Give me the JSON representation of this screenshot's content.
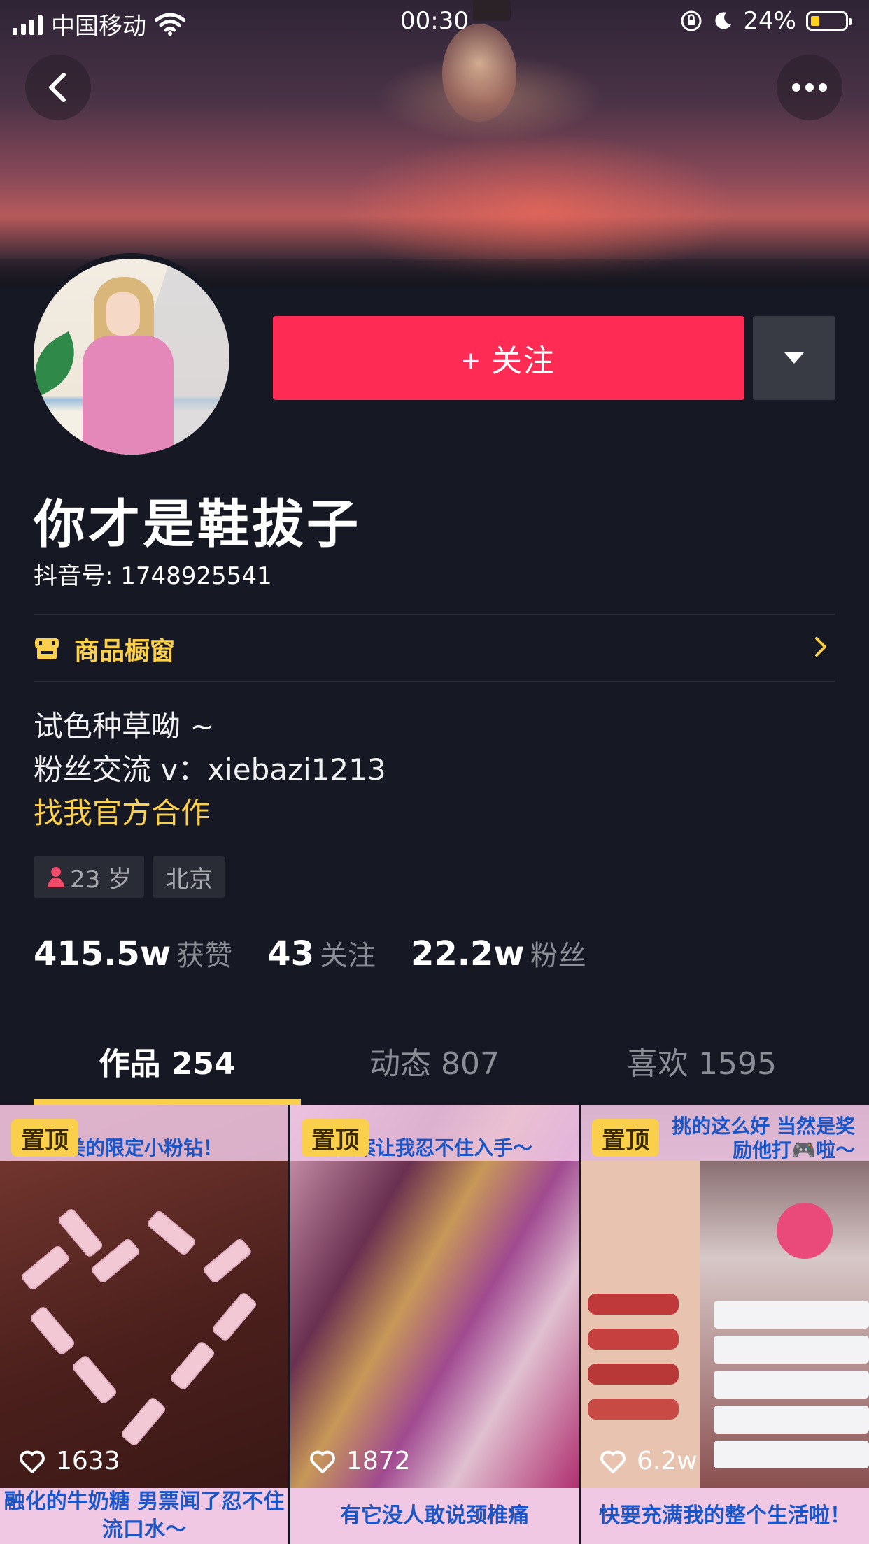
{
  "status_bar": {
    "carrier": "中国移动",
    "time": "00:30",
    "battery": "24%"
  },
  "profile": {
    "follow_label": "+ 关注",
    "nickname": "你才是鞋拔子",
    "douyin_id": "抖音号: 1748925541",
    "shop_label": "商品橱窗",
    "bio_line1": "试色种草呦 ~",
    "bio_line2": "粉丝交流 v：xiebazi1213",
    "bio_line3": "找我官方合作",
    "tag_age": "23 岁",
    "tag_city": "北京"
  },
  "stats": [
    {
      "value": "415.5w",
      "label": "获赞"
    },
    {
      "value": "43",
      "label": "关注"
    },
    {
      "value": "22.2w",
      "label": "粉丝"
    }
  ],
  "tabs": [
    {
      "label": "作品 254"
    },
    {
      "label": "动态 807"
    },
    {
      "label": "喜欢 1595"
    }
  ],
  "videos": [
    {
      "pin": "置顶",
      "likes": "1633",
      "caption": "美的限定小粉钻！"
    },
    {
      "pin": "置顶",
      "likes": "1872",
      "caption": "图案让我忍不住入手～"
    },
    {
      "pin": "置顶",
      "likes": "6.2w",
      "caption": "挑的这么好 当然是奖励他打🎮啦～"
    }
  ],
  "videos_row2": [
    {
      "caption": "融化的牛奶糖 男票闻了忍不住流口水～"
    },
    {
      "caption": "有它没人敢说颈椎痛"
    },
    {
      "caption": "快要充满我的整个生活啦！"
    }
  ],
  "colors": {
    "background": "#161823",
    "follow": "#fe2c55",
    "gold": "#facf4b"
  }
}
